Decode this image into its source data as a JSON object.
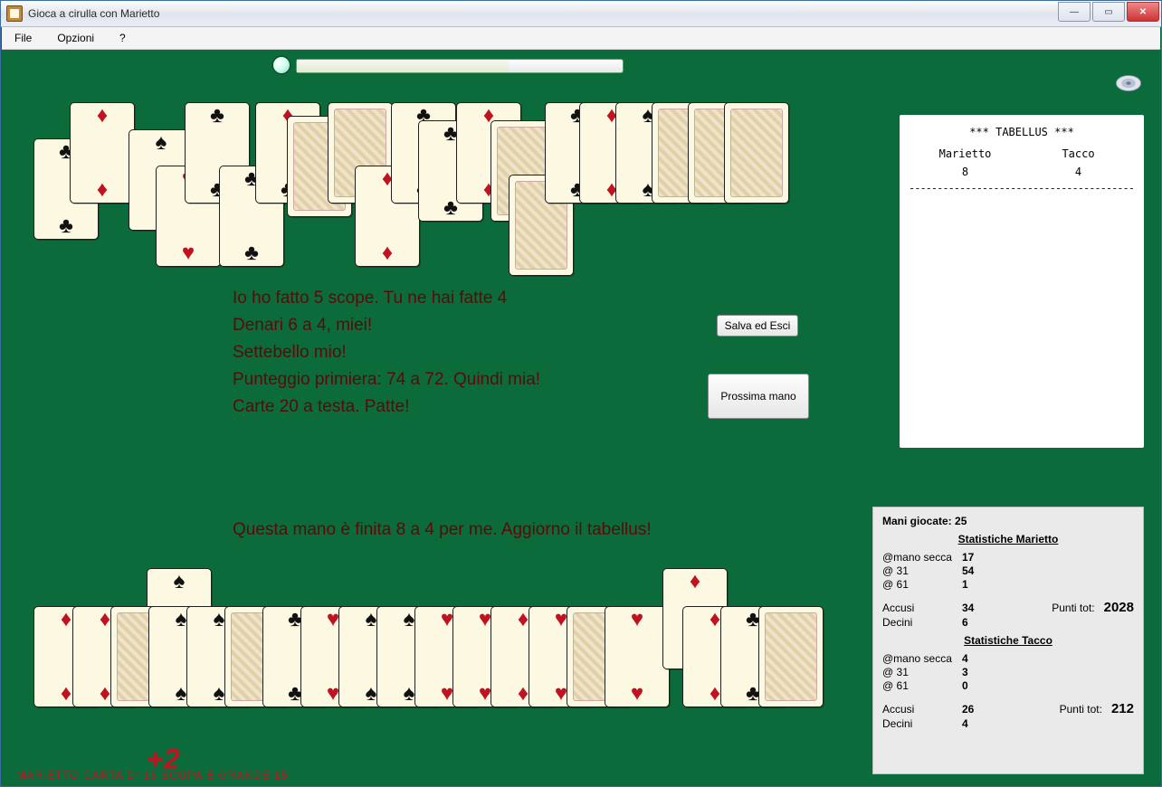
{
  "window": {
    "title": "Gioca a cirulla con Marietto"
  },
  "menu": {
    "file": "File",
    "opzioni": "Opzioni",
    "help": "?"
  },
  "tabellus": {
    "header": "*** TABELLUS ***",
    "p1": "Marietto",
    "p1_score": "8",
    "p2": "Tacco",
    "p2_score": "4",
    "rule": "------------------------------------------------------------------------------"
  },
  "announce": {
    "l1": "Io ho fatto 5 scope. Tu ne hai fatte 4",
    "l2": "Denari 6 a 4, miei!",
    "l3": "Settebello mio!",
    "l4": "Punteggio primiera: 74 a 72. Quindi mia!",
    "l5": "Carte 20 a testa. Patte!"
  },
  "summary": "Questa mano è finita 8 a 4 per me. Aggiorno il tabellus!",
  "buttons": {
    "save": "Salva ed Esci",
    "next": "Prossima mano"
  },
  "stats": {
    "hands_label": "Mani giocate:",
    "hands": "25",
    "m_title": "Statistiche Marietto",
    "ms_lab": "@mano secca",
    "ms_val": "17",
    "m31_lab": "@ 31",
    "m31_val": "54",
    "m61_lab": "@ 61",
    "m61_val": "1",
    "macc_lab": "Accusi",
    "macc_val": "34",
    "mdec_lab": "Decini",
    "mdec_val": "6",
    "mpt_lab": "Punti tot:",
    "mpt_val": "2028",
    "t_title": "Statistiche Tacco",
    "ts_lab": "@mano secca",
    "ts_val": "4",
    "t31_lab": "@ 31",
    "t31_val": "3",
    "t61_lab": "@ 61",
    "t61_val": "0",
    "tacc_lab": "Accusi",
    "tacc_val": "26",
    "tdec_lab": "Decini",
    "tdec_val": "4",
    "tpt_lab": "Punti tot:",
    "tpt_val": "212"
  },
  "bonus": {
    "value": "+2",
    "label": "MARIETTO CARTA DI 15   SCOPA E GRANDE 15"
  },
  "suits": {
    "diamond": "♦",
    "club": "♣",
    "heart": "♥",
    "spade": "♠"
  }
}
